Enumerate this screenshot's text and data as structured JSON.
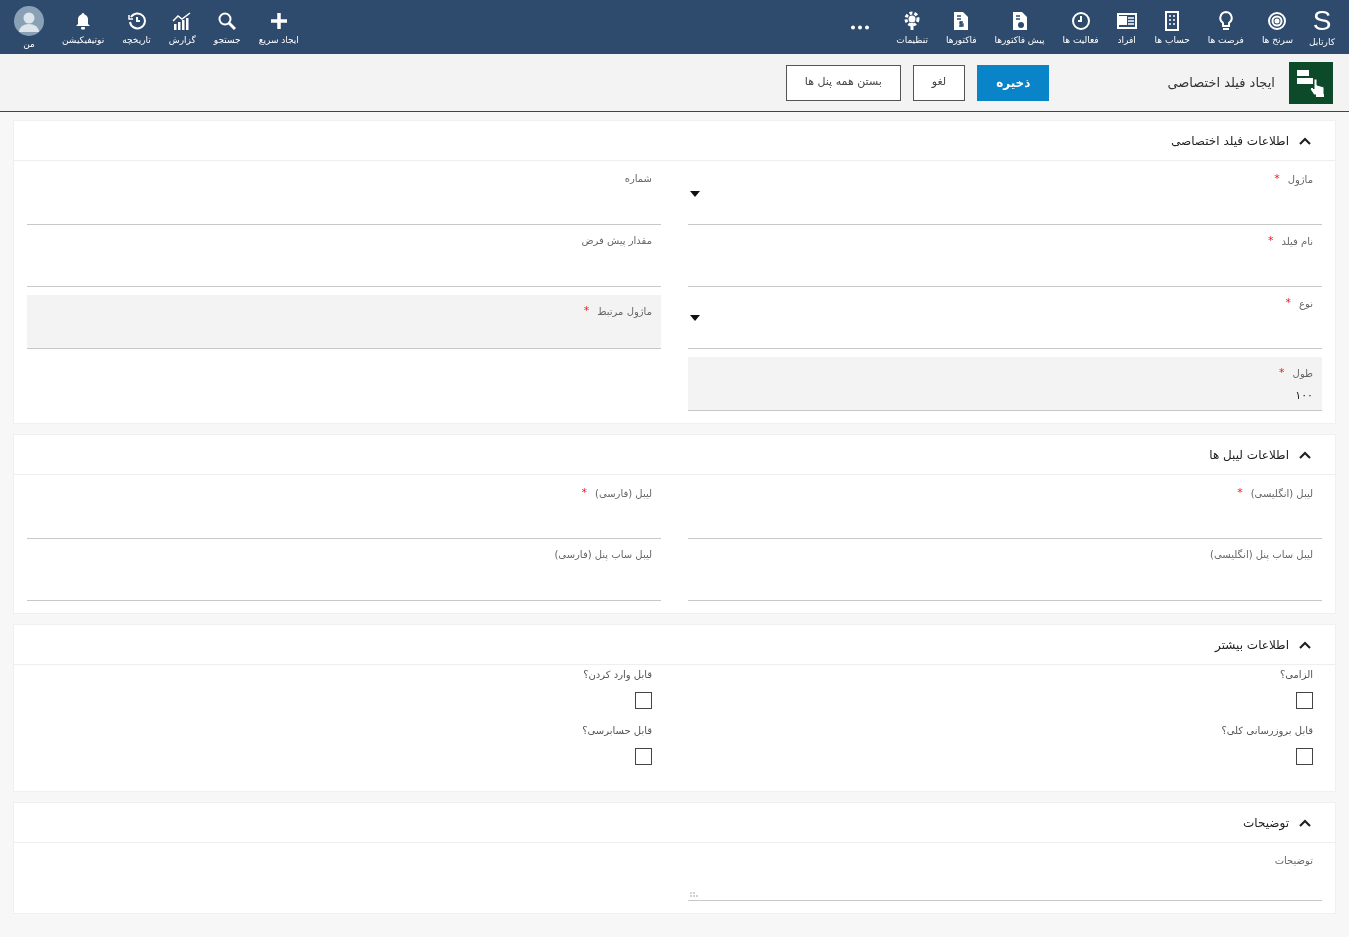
{
  "nav": {
    "brand": {
      "letter": "S",
      "label": "کارتابل"
    },
    "modules": [
      {
        "label": "سرنخ ها"
      },
      {
        "label": "فرصت ها"
      },
      {
        "label": "حساب ها"
      },
      {
        "label": "افراد"
      },
      {
        "label": "فعالیت ها"
      },
      {
        "label": "پیش فاکتورها"
      },
      {
        "label": "فاکتورها"
      },
      {
        "label": "تنظیمات"
      }
    ],
    "tools": [
      {
        "label": "ایجاد سریع"
      },
      {
        "label": "جستجو"
      },
      {
        "label": "گزارش"
      },
      {
        "label": "تاریخچه"
      },
      {
        "label": "نوتیفیکیشن"
      }
    ],
    "user": {
      "label": "من"
    }
  },
  "header": {
    "title": "ایجاد فیلد اختصاصی",
    "buttons": [
      {
        "label": "ذخیره",
        "kind": "primary"
      },
      {
        "label": "لغو",
        "kind": "default"
      },
      {
        "label": "بستن همه پنل ها",
        "kind": "default"
      }
    ]
  },
  "sections": [
    {
      "title": "اطلاعات فیلد اختصاصی",
      "expanded": true,
      "columns": [
        [
          {
            "kind": "select",
            "label": "ماژول",
            "required_marker": "*",
            "disabled": false
          },
          {
            "kind": "text",
            "label": "نام فیلد",
            "required_marker": "*",
            "disabled": false
          },
          {
            "kind": "select",
            "label": "نوع",
            "required_marker": "*",
            "disabled": false
          },
          {
            "kind": "text",
            "label": "طول",
            "required_marker": "*",
            "disabled": true,
            "value": "۱۰۰"
          }
        ],
        [
          {
            "kind": "text",
            "label": "شماره",
            "disabled": false
          },
          {
            "kind": "text",
            "label": "مقدار پیش فرض",
            "disabled": false
          },
          {
            "kind": "text",
            "label": "ماژول مرتبط",
            "required_marker": "*",
            "disabled": true
          }
        ]
      ]
    },
    {
      "title": "اطلاعات لیبل ها",
      "expanded": true,
      "columns": [
        [
          {
            "kind": "text",
            "label": "لیبل (انگلیسی)",
            "required_marker": "*",
            "disabled": false
          },
          {
            "kind": "text",
            "label": "لیبل ساب پنل (انگلیسی)",
            "disabled": false
          }
        ],
        [
          {
            "kind": "text",
            "label": "لیبل (فارسی)",
            "required_marker": "*",
            "disabled": false
          },
          {
            "kind": "text",
            "label": "لیبل ساب پنل (فارسی)",
            "disabled": false
          }
        ]
      ]
    },
    {
      "title": "اطلاعات بیشتر",
      "expanded": true,
      "columns": [
        [
          {
            "kind": "checkbox",
            "label": "الزامی؟",
            "checked": false
          },
          {
            "kind": "checkbox",
            "label": "قابل بروزرسانی کلی؟",
            "checked": false
          }
        ],
        [
          {
            "kind": "checkbox",
            "label": "قابل وارد کردن؟",
            "checked": false
          },
          {
            "kind": "checkbox",
            "label": "قابل حسابرسی؟",
            "checked": false
          }
        ]
      ]
    },
    {
      "title": "توضیحات",
      "expanded": true,
      "columns": [
        [
          {
            "kind": "textarea",
            "label": "توضیحات",
            "disabled": false
          }
        ],
        []
      ]
    }
  ]
}
